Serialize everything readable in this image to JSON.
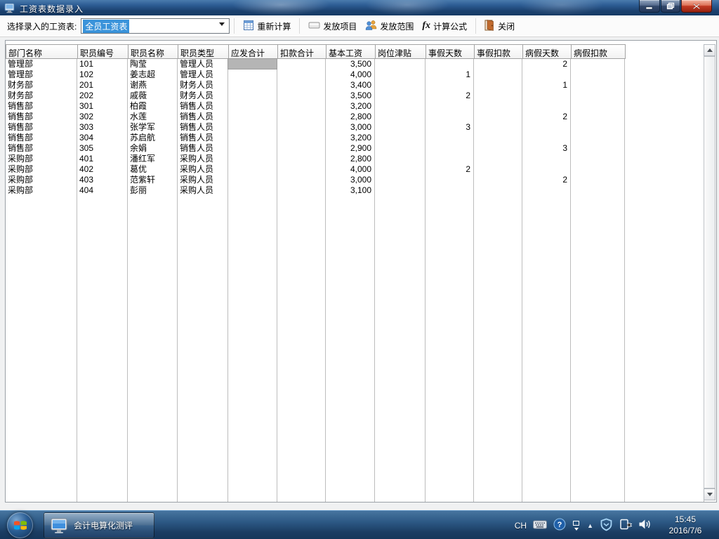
{
  "window": {
    "title": "工资表数据录入"
  },
  "toolbar": {
    "select_label": "选择录入的工资表:",
    "combo_value": "全员工资表",
    "buttons": [
      {
        "label": "重新计算",
        "icon": "calculator-table-icon"
      },
      {
        "label": "发放项目",
        "icon": "field-box-icon"
      },
      {
        "label": "发放范围",
        "icon": "people-icon"
      },
      {
        "label": "计算公式",
        "icon": "fx-icon"
      },
      {
        "label": "关闭",
        "icon": "door-icon"
      }
    ]
  },
  "grid": {
    "columns": [
      "部门名称",
      "职员编号",
      "职员名称",
      "职员类型",
      "应发合计",
      "扣款合计",
      "基本工资",
      "岗位津贴",
      "事假天数",
      "事假扣款",
      "病假天数",
      "病假扣款"
    ],
    "rows": [
      [
        "管理部",
        "101",
        "陶莹",
        "管理人员",
        "",
        "",
        "3,500",
        "",
        "",
        "",
        "2",
        ""
      ],
      [
        "管理部",
        "102",
        "姜志超",
        "管理人员",
        "",
        "",
        "4,000",
        "",
        "1",
        "",
        "",
        ""
      ],
      [
        "财务部",
        "201",
        "谢燕",
        "财务人员",
        "",
        "",
        "3,400",
        "",
        "",
        "",
        "1",
        ""
      ],
      [
        "财务部",
        "202",
        "戚薇",
        "财务人员",
        "",
        "",
        "3,500",
        "",
        "2",
        "",
        "",
        ""
      ],
      [
        "销售部",
        "301",
        "柏霞",
        "销售人员",
        "",
        "",
        "3,200",
        "",
        "",
        "",
        "",
        ""
      ],
      [
        "销售部",
        "302",
        "水莲",
        "销售人员",
        "",
        "",
        "2,800",
        "",
        "",
        "",
        "2",
        ""
      ],
      [
        "销售部",
        "303",
        "张学军",
        "销售人员",
        "",
        "",
        "3,000",
        "",
        "3",
        "",
        "",
        ""
      ],
      [
        "销售部",
        "304",
        "苏启航",
        "销售人员",
        "",
        "",
        "3,200",
        "",
        "",
        "",
        "",
        ""
      ],
      [
        "销售部",
        "305",
        "余娟",
        "销售人员",
        "",
        "",
        "2,900",
        "",
        "",
        "",
        "3",
        ""
      ],
      [
        "采购部",
        "401",
        "潘红军",
        "采购人员",
        "",
        "",
        "2,800",
        "",
        "",
        "",
        "",
        ""
      ],
      [
        "采购部",
        "402",
        "葛优",
        "采购人员",
        "",
        "",
        "4,000",
        "",
        "2",
        "",
        "",
        ""
      ],
      [
        "采购部",
        "403",
        "范紫轩",
        "采购人员",
        "",
        "",
        "3,000",
        "",
        "",
        "",
        "2",
        ""
      ],
      [
        "采购部",
        "404",
        "彭丽",
        "采购人员",
        "",
        "",
        "3,100",
        "",
        "",
        "",
        "",
        ""
      ]
    ],
    "selected_cell": {
      "row": 0,
      "col": 4
    }
  },
  "taskbar": {
    "app_button_label": "会计电算化测评",
    "tray": {
      "lang": "CH",
      "time": "15:45",
      "date": "2016/7/6"
    }
  },
  "colors": {
    "selection_blue": "#3a93da",
    "selected_cell_gray": "#b5b5b5",
    "titlebar_blue": "#1b416f",
    "taskbar_blue": "#2c5884"
  }
}
